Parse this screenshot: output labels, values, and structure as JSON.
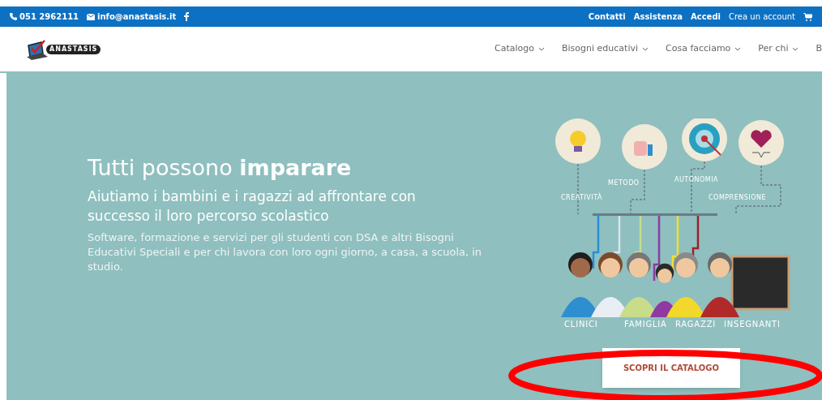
{
  "top_bar": {
    "phone": "051 2962111",
    "email": "info@anastasis.it",
    "links": [
      {
        "label": "Contatti",
        "bold": true
      },
      {
        "label": "Assistenza",
        "bold": true
      },
      {
        "label": "Accedi",
        "bold": true
      },
      {
        "label": "Crea un account",
        "bold": false
      }
    ]
  },
  "header": {
    "logo": "ANASTASIS",
    "nav": [
      {
        "label": "Catalogo",
        "dropdown": true
      },
      {
        "label": "Bisogni educativi",
        "dropdown": true
      },
      {
        "label": "Cosa facciamo",
        "dropdown": true
      },
      {
        "label": "Per chi",
        "dropdown": true
      },
      {
        "label": "B",
        "dropdown": false
      }
    ]
  },
  "hero": {
    "title": "Tutti possono **imparare**",
    "subtitle": "Aiutiamo i bambini e i ragazzi ad affrontare con successo il loro percorso scolastico",
    "description": "Software, formazione e servizi per gli studenti con DSA e altri Bisogni Educativi Speciali e per chi lavora con loro ogni giorno, a casa, a scuola, in studio.",
    "illustration": {
      "values": [
        "CREATIVITÀ",
        "METODO",
        "AUTONOMIA",
        "COMPRENSIONE"
      ],
      "people": [
        "CLINICI",
        "FAMIGLIA",
        "RAGAZZI",
        "INSEGNANTI"
      ]
    },
    "button": "SCOPRI IL CATALOGO"
  }
}
